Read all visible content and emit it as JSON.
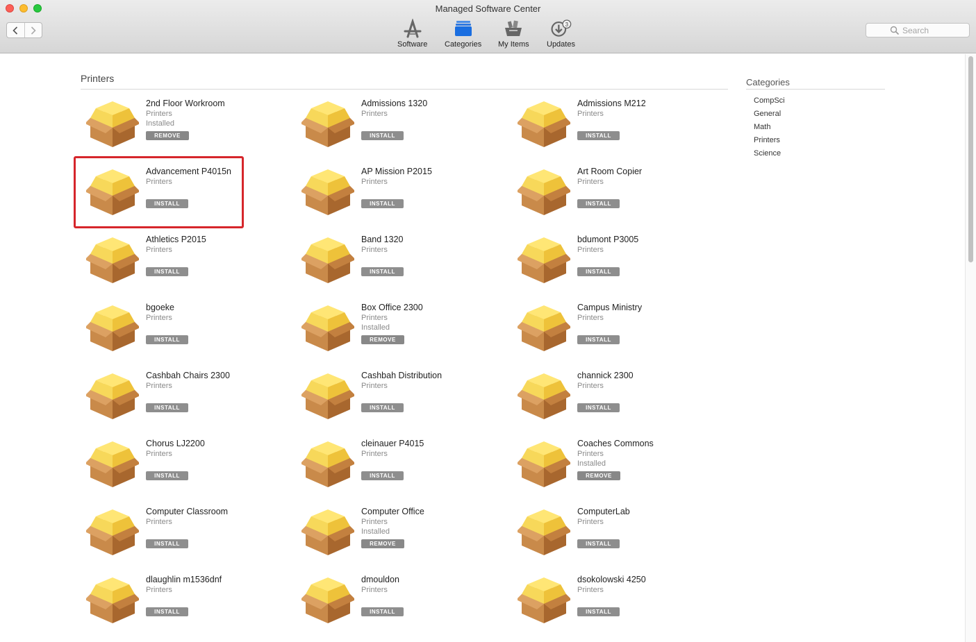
{
  "window": {
    "title": "Managed Software Center"
  },
  "toolbar": {
    "tabs": [
      {
        "label": "Software",
        "icon": "app-store-icon"
      },
      {
        "label": "Categories",
        "icon": "categories-icon"
      },
      {
        "label": "My Items",
        "icon": "my-items-icon"
      },
      {
        "label": "Updates",
        "icon": "updates-icon",
        "badge": "3"
      }
    ],
    "search_placeholder": "Search"
  },
  "main": {
    "section_title": "Printers",
    "items": [
      {
        "name": "2nd Floor Workroom",
        "category": "Printers",
        "status": "Installed",
        "action": "REMOVE"
      },
      {
        "name": "Admissions 1320",
        "category": "Printers",
        "status": "",
        "action": "INSTALL"
      },
      {
        "name": "Admissions M212",
        "category": "Printers",
        "status": "",
        "action": "INSTALL"
      },
      {
        "name": "Advancement P4015n",
        "category": "Printers",
        "status": "",
        "action": "INSTALL"
      },
      {
        "name": "AP Mission P2015",
        "category": "Printers",
        "status": "",
        "action": "INSTALL"
      },
      {
        "name": "Art Room Copier",
        "category": "Printers",
        "status": "",
        "action": "INSTALL"
      },
      {
        "name": "Athletics P2015",
        "category": "Printers",
        "status": "",
        "action": "INSTALL"
      },
      {
        "name": "Band 1320",
        "category": "Printers",
        "status": "",
        "action": "INSTALL"
      },
      {
        "name": "bdumont P3005",
        "category": "Printers",
        "status": "",
        "action": "INSTALL"
      },
      {
        "name": "bgoeke",
        "category": "Printers",
        "status": "",
        "action": "INSTALL"
      },
      {
        "name": "Box Office 2300",
        "category": "Printers",
        "status": "Installed",
        "action": "REMOVE"
      },
      {
        "name": "Campus Ministry",
        "category": "Printers",
        "status": "",
        "action": "INSTALL"
      },
      {
        "name": "Cashbah Chairs 2300",
        "category": "Printers",
        "status": "",
        "action": "INSTALL"
      },
      {
        "name": "Cashbah Distribution",
        "category": "Printers",
        "status": "",
        "action": "INSTALL"
      },
      {
        "name": "channick 2300",
        "category": "Printers",
        "status": "",
        "action": "INSTALL"
      },
      {
        "name": "Chorus LJ2200",
        "category": "Printers",
        "status": "",
        "action": "INSTALL"
      },
      {
        "name": "cleinauer P4015",
        "category": "Printers",
        "status": "",
        "action": "INSTALL"
      },
      {
        "name": "Coaches Commons",
        "category": "Printers",
        "status": "Installed",
        "action": "REMOVE"
      },
      {
        "name": "Computer Classroom",
        "category": "Printers",
        "status": "",
        "action": "INSTALL"
      },
      {
        "name": "Computer Office",
        "category": "Printers",
        "status": "Installed",
        "action": "REMOVE"
      },
      {
        "name": "ComputerLab",
        "category": "Printers",
        "status": "",
        "action": "INSTALL"
      },
      {
        "name": "dlaughlin m1536dnf",
        "category": "Printers",
        "status": "",
        "action": "INSTALL"
      },
      {
        "name": "dmouldon",
        "category": "Printers",
        "status": "",
        "action": "INSTALL"
      },
      {
        "name": "dsokolowski 4250",
        "category": "Printers",
        "status": "",
        "action": "INSTALL"
      }
    ]
  },
  "sidebar": {
    "title": "Categories",
    "links": [
      "CompSci",
      "General",
      "Math",
      "Printers",
      "Science"
    ]
  },
  "colors": {
    "highlight": "#d6262b",
    "categories_icon": "#1a6ee0",
    "button_gray": "#8e8e8e"
  }
}
